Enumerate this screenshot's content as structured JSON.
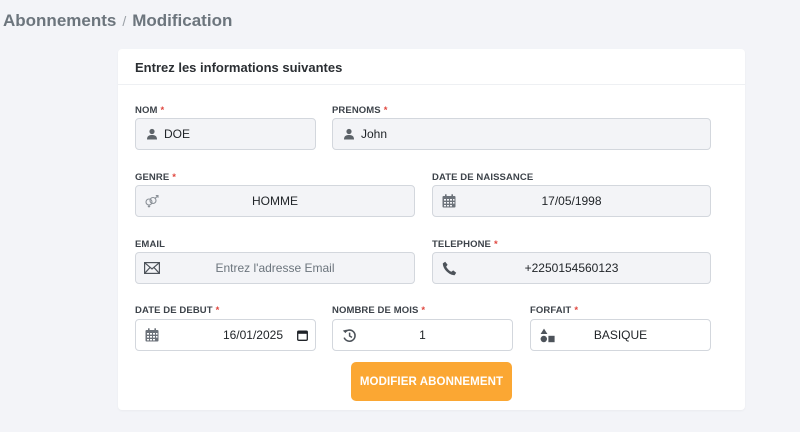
{
  "breadcrumb": {
    "section": "Abonnements",
    "separator": "/",
    "current": "Modification"
  },
  "card": {
    "title": "Entrez les informations suivantes"
  },
  "form": {
    "nom": {
      "label": "NOM",
      "required": "*",
      "value": "DOE",
      "icon": "user-icon"
    },
    "prenoms": {
      "label": "PRENOMS",
      "required": "*",
      "value": "John",
      "icon": "user-icon"
    },
    "genre": {
      "label": "GENRE",
      "required": "*",
      "value": "HOMME",
      "icon": "gender-icon"
    },
    "date_naissance": {
      "label": "DATE DE NAISSANCE",
      "value": "17/05/1998",
      "icon": "calendar-icon"
    },
    "email": {
      "label": "EMAIL",
      "placeholder": "Entrez l'adresse  Email",
      "icon": "envelope-icon"
    },
    "telephone": {
      "label": "TELEPHONE",
      "required": "*",
      "value": "+2250154560123",
      "icon": "phone-icon"
    },
    "date_debut": {
      "label": "DATE DE DEBUT",
      "required": "*",
      "value": "16/01/2025",
      "icon": "calendar-icon"
    },
    "nombre_mois": {
      "label": "NOMBRE DE MOIS",
      "required": "*",
      "value": "1",
      "icon": "history-icon"
    },
    "forfait": {
      "label": "FORFAIT",
      "required": "*",
      "value": "BASIQUE",
      "icon": "shapes-icon"
    }
  },
  "submit": {
    "label": "MODIFIER ABONNEMENT"
  },
  "colors": {
    "accent": "#fba733",
    "required": "#e0473f",
    "input_bg": "#f3f4f7"
  }
}
